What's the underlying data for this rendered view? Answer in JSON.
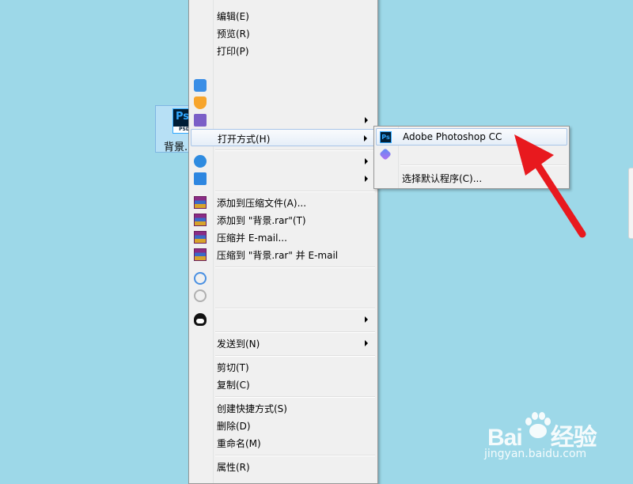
{
  "desktop": {
    "file_icon_name": "photoshop-file-icon",
    "file_icon_text": "Ps",
    "file_icon_badge": "PSD",
    "file_name": "背景.p"
  },
  "context_menu": {
    "items": [
      {
        "label": "编辑(E)"
      },
      {
        "label": "预览(R)"
      },
      {
        "label": "打印(P)"
      },
      {
        "label": "打开方式(H)",
        "has_submenu": true,
        "highlighted": true
      },
      {
        "label": "添加到压缩文件(A)..."
      },
      {
        "label": "添加到 \"背景.rar\"(T)"
      },
      {
        "label": "压缩并 E-mail..."
      },
      {
        "label": "压缩到 \"背景.rar\" 并 E-mail"
      },
      {
        "label": "发送到(N)",
        "has_submenu": true
      },
      {
        "label": "剪切(T)"
      },
      {
        "label": "复制(C)"
      },
      {
        "label": "创建快捷方式(S)"
      },
      {
        "label": "删除(D)"
      },
      {
        "label": "重命名(M)"
      },
      {
        "label": "属性(R)"
      }
    ],
    "icons": [
      "blue-bird-icon",
      "flame-icon",
      "purple-app-icon",
      "cloud-upload-icon",
      "arrow-box-icon",
      "winrar-icon",
      "baidu-netdisk-icon",
      "grey-app-icon",
      "qq-penguin-icon"
    ]
  },
  "open_with_submenu": {
    "items": [
      {
        "label": "Adobe Photoshop CC",
        "highlighted": true,
        "icon": "photoshop-icon"
      },
      {
        "label": "",
        "icon": "hexagon-app-icon"
      },
      {
        "label": "选择默认程序(C)..."
      }
    ]
  },
  "annotation": {
    "arrow_color": "#e8191e"
  },
  "watermark": {
    "brand_left": "Bai",
    "brand_right": "经验",
    "url": "jingyan.baidu.com"
  },
  "colors": {
    "desktop_bg": "#9dd8e8",
    "menu_bg": "#f0f0f0",
    "highlight_border": "#a8c5e8"
  }
}
